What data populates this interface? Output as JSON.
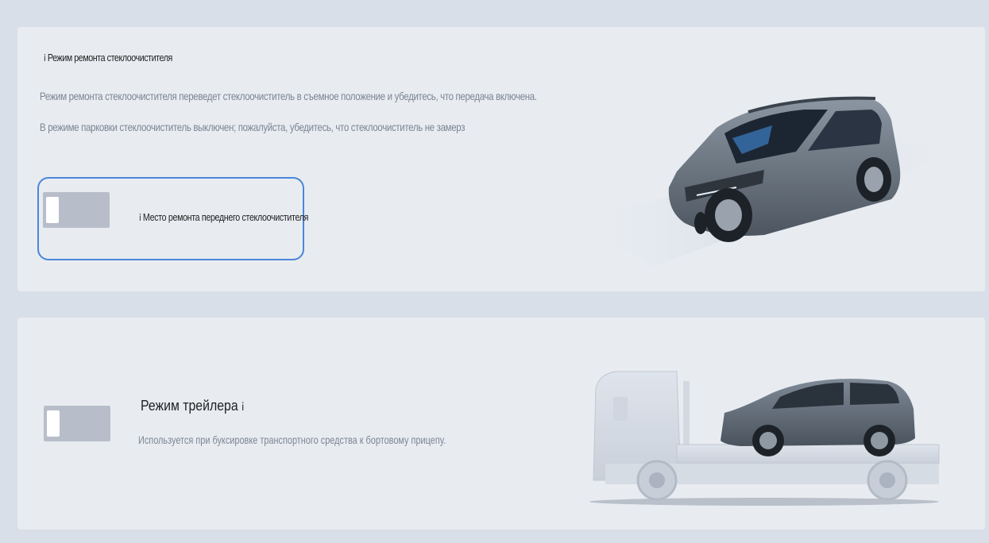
{
  "wiper_section": {
    "title": "Режим ремонта стеклоочистителя",
    "description_1": "Режим ремонта стеклоочистителя переведет стеклоочиститель в съемное положение и убедитесь, что передача включена.",
    "description_2": "В режиме парковки стеклоочиститель выключен; пожалуйста, убедитесь, что стеклоочиститель не замерз",
    "option": {
      "label": "Место ремонта переднего стеклоочистителя",
      "enabled": false
    },
    "image": "suv-car-illustration"
  },
  "trailer_section": {
    "title": "Режим трейлера",
    "description": "Используется при буксировке транспортного средства к бортовому прицепу.",
    "enabled": false,
    "image": "flatbed-truck-with-car-illustration"
  },
  "colors": {
    "background": "#d9dfe8",
    "card": "#e8ecf1",
    "accent": "#4a86d9",
    "toggle_off": "#b8bec9"
  }
}
